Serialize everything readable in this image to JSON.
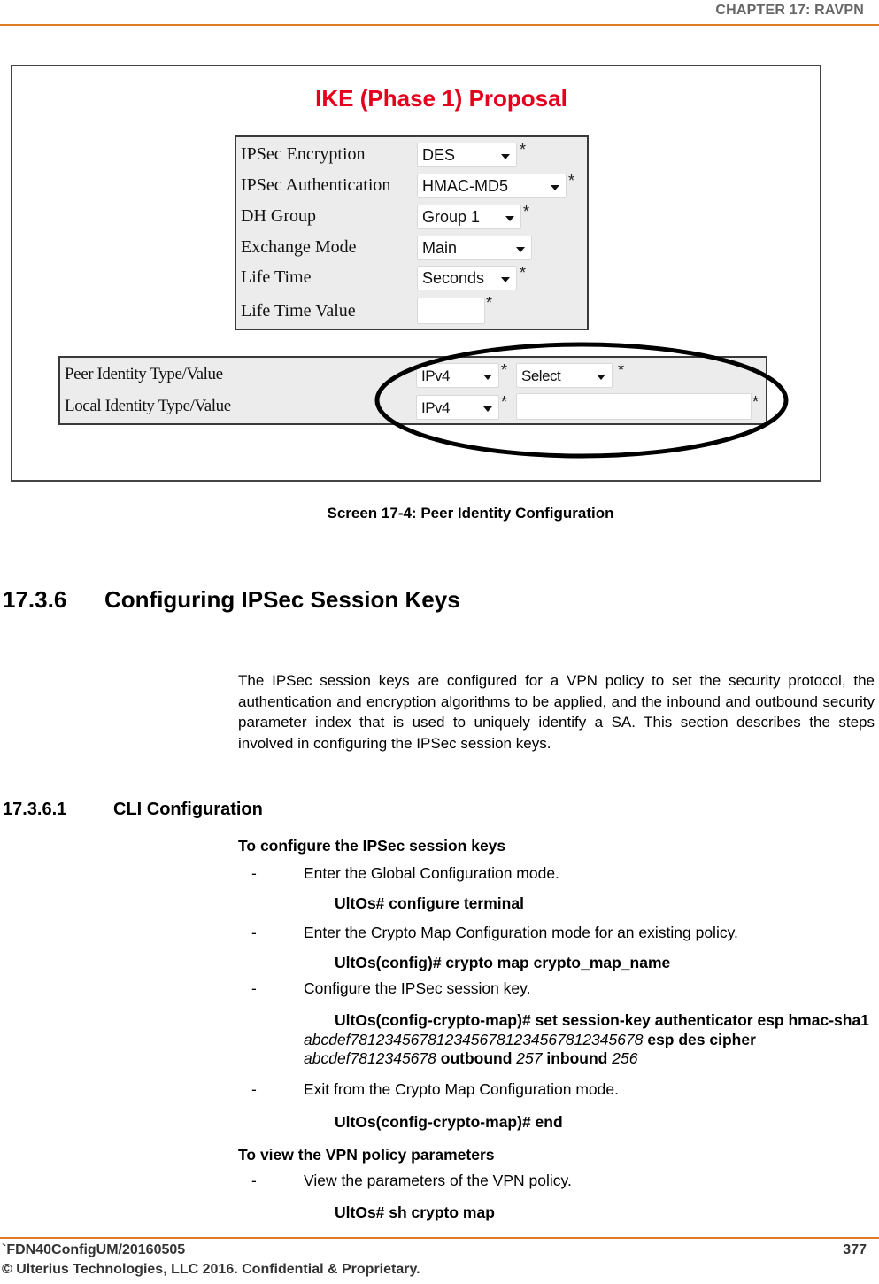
{
  "header": {
    "chapter": "CHAPTER 17: RAVPN"
  },
  "screenshot": {
    "title": "IKE (Phase 1) Proposal",
    "required_mark": "*",
    "fields": [
      {
        "label": "IPSec Encryption",
        "type": "select",
        "value": "DES",
        "required": true
      },
      {
        "label": "IPSec Authentication",
        "type": "select",
        "value": "HMAC-MD5",
        "required": true
      },
      {
        "label": "DH Group",
        "type": "select",
        "value": "Group 1",
        "required": true
      },
      {
        "label": "Exchange Mode",
        "type": "select",
        "value": "Main",
        "required": false
      },
      {
        "label": "Life Time",
        "type": "select",
        "value": "Seconds",
        "required": true
      },
      {
        "label": "Life Time Value",
        "type": "text",
        "value": "",
        "required": true
      }
    ],
    "identity_fields": [
      {
        "label": "Peer Identity Type/Value",
        "type_value": "IPv4",
        "value_type": "select",
        "value": "Select"
      },
      {
        "label": "Local Identity Type/Value",
        "type_value": "IPv4",
        "value_type": "text",
        "value": ""
      }
    ],
    "annotation": "oval-highlight"
  },
  "caption": "Screen 17-4: Peer Identity Configuration",
  "section": {
    "number": "17.3.6",
    "title": "Configuring IPSec Session Keys"
  },
  "intro": "The IPSec session keys are configured for a VPN policy to set the security protocol, the authentication and encryption algorithms to be applied, and the inbound and outbound security parameter index that is used to uniquely identify a SA. This section describes the steps involved in configuring the IPSec session keys.",
  "subsection": {
    "number": "17.3.6.1",
    "title": "CLI Configuration"
  },
  "procedures": [
    {
      "title": "To configure the IPSec session keys",
      "steps": [
        {
          "dash": "-",
          "text": "Enter the Global Configuration mode.",
          "command": "UltOs# configure terminal"
        },
        {
          "dash": "-",
          "text": "Enter the Crypto Map Configuration mode for an existing policy.",
          "command": "UltOs(config)# crypto map crypto_map_name"
        },
        {
          "dash": "-",
          "text": "Configure the IPSec session key.",
          "command_parts": {
            "p1": "UltOs(config-crypto-map)# set session-key authenticator esp hmac-sha1",
            "v1": "abcdef7812345678123456781234567812345678",
            "p2": "esp des cipher",
            "v2": "abcdef7812345678",
            "p3": "outbound",
            "v3": "257",
            "p4": "inbound",
            "v4": "256"
          }
        },
        {
          "dash": "-",
          "text": "Exit from the Crypto Map Configuration mode.",
          "command": "UltOs(config-crypto-map)# end"
        }
      ]
    },
    {
      "title": "To view the VPN policy parameters",
      "steps": [
        {
          "dash": "-",
          "text": "View the parameters of the VPN policy.",
          "command": "UltOs# sh crypto map"
        }
      ]
    }
  ],
  "footer": {
    "doc_id": "`FDN40ConfigUM/20160505",
    "page_number": "377",
    "copyright": "© Ulterius Technologies, LLC 2016. Confidential & Proprietary."
  },
  "colors": {
    "accent_rule": "#e07b28",
    "screenshot_title": "#e5001e"
  }
}
